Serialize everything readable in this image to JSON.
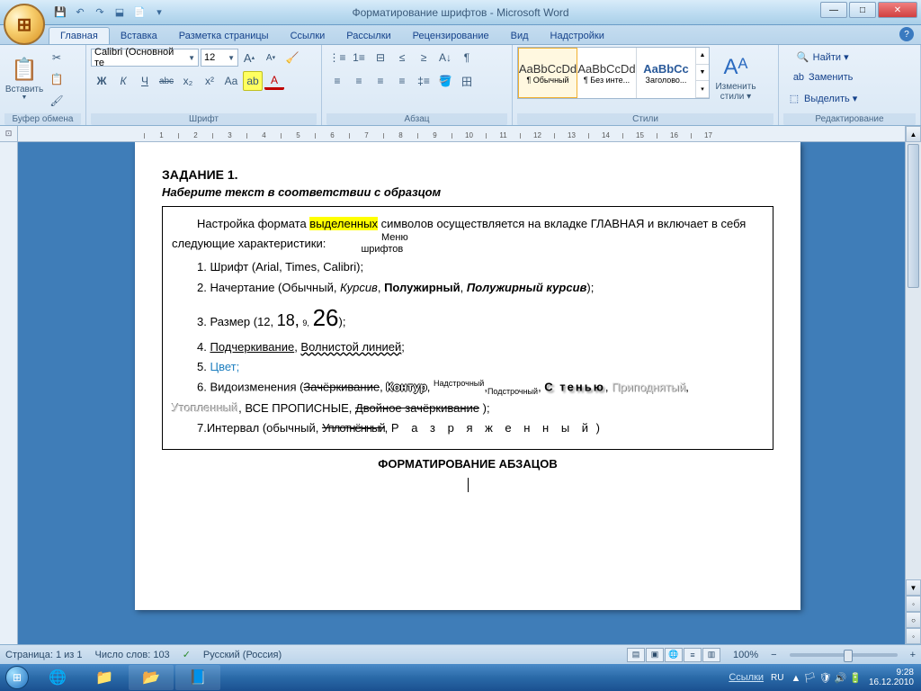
{
  "titlebar": {
    "title": "Форматирование шрифтов - Microsoft Word",
    "qat": {
      "save": "💾",
      "undo": "↶",
      "redo": "↷",
      "extra1": "⬓",
      "extra2": "📄"
    }
  },
  "tabs": {
    "items": [
      "Главная",
      "Вставка",
      "Разметка страницы",
      "Ссылки",
      "Рассылки",
      "Рецензирование",
      "Вид",
      "Надстройки"
    ],
    "active": 0,
    "help": "?"
  },
  "ribbon": {
    "clipboard": {
      "label": "Буфер обмена",
      "paste": "Вставить",
      "cut": "✂",
      "copy": "📋",
      "brush": "🖌"
    },
    "font": {
      "label": "Шрифт",
      "family": "Calibri (Основной те",
      "size": "12",
      "grow": "A",
      "shrink": "A",
      "clear": "Aa",
      "bold": "Ж",
      "italic": "К",
      "underline": "Ч",
      "strike": "abc",
      "sub": "x₂",
      "sup": "x²",
      "case": "Aa",
      "highlight": "ab",
      "color": "A"
    },
    "paragraph": {
      "label": "Абзац",
      "bullets": "≣",
      "numbers": "≡",
      "multilevel": "⊟",
      "indentL": "≤",
      "indentR": "≥",
      "sort": "A↓",
      "marks": "¶",
      "alignL": "≡",
      "alignC": "≡",
      "alignR": "≡",
      "justify": "≡",
      "spacing": "↕",
      "shading": "▢",
      "borders": "田"
    },
    "styles": {
      "label": "Стили",
      "items": [
        {
          "sample": "AaBbCcDd",
          "name": "¶ Обычный"
        },
        {
          "sample": "AaBbCcDd",
          "name": "¶ Без инте..."
        },
        {
          "sample": "AaBbCc",
          "name": "Заголово..."
        }
      ],
      "change": "Изменить стили ▾"
    },
    "editing": {
      "label": "Редактирование",
      "find": "Найти ▾",
      "replace": "Заменить",
      "select": "Выделить ▾"
    }
  },
  "ruler": {
    "marks": [
      "1",
      "",
      "1",
      "2",
      "3",
      "4",
      "5",
      "6",
      "7",
      "8",
      "9",
      "10",
      "11",
      "12",
      "13",
      "14",
      "15",
      "16",
      "17",
      "18"
    ]
  },
  "document": {
    "heading": "ЗАДАНИЕ 1.",
    "instruction": "Наберите текст в соответствии с образцом",
    "intro_a": "Настройка формата ",
    "intro_hl": "выделенных",
    "intro_b": " символов осуществляется на вкладке ГЛАВНАЯ и включает в себя следующие характеристики:",
    "menu_note_l1": "Меню",
    "menu_note_l2": "шрифтов",
    "li1": "1. Шрифт (Arial, Times, Calibri);",
    "li2_a": "2. Начертание (Обычный, ",
    "li2_i": "Курсив",
    "li2_b": ", ",
    "li2_bold": "Полужирный",
    "li2_c": ", ",
    "li2_bi": "Полужирный курсив",
    "li2_d": ");",
    "li3_a": "3. Размер (12, ",
    "li3_18": "18,",
    "li3_b": " ",
    "li3_9": "9,",
    "li3_c": " ",
    "li3_26": "26",
    "li3_d": ");",
    "li4_a": "4. ",
    "li4_u": "Подчеркивание",
    "li4_b": ", ",
    "li4_w": "Волнистой линией",
    "li4_c": ";",
    "li5_a": "5. ",
    "li5_c": "Цвет;",
    "li6_a": "6. Видоизменения (",
    "li6_s": "Зачёркивание",
    "li6_b": ", ",
    "li6_o": "Контур",
    "li6_c": ", ",
    "li6_sup": "Надстрочный",
    "li6_d": ",",
    "li6_sub": "Подстрочный",
    "li6_e": ", ",
    "li6_sh": "С  тенью",
    "li6_f": ", ",
    "li6_em": "Приподнятый",
    "li6_g": ", ",
    "li6_en": "Утопленный",
    "li6_h": ", ВСЕ ПРОПИСНЫЕ, ",
    "li6_ds": "Двойное зачёркивание",
    "li6_i": " );",
    "li7_a": "7.Интервал (обычный, ",
    "li7_d": "Уплотнённый",
    "li7_b": ", ",
    "li7_sp": "Р а з р я ж е н н ы й",
    "li7_c": " )",
    "center": "ФОРМАТИРОВАНИЕ АБЗАЦОВ"
  },
  "statusbar": {
    "page": "Страница: 1 из 1",
    "words": "Число слов: 103",
    "lang": "Русский (Россия)",
    "zoom": "100%"
  },
  "taskbar": {
    "link": "Ссылки",
    "lang": "RU",
    "time": "9:28",
    "date": "16.12.2010"
  }
}
